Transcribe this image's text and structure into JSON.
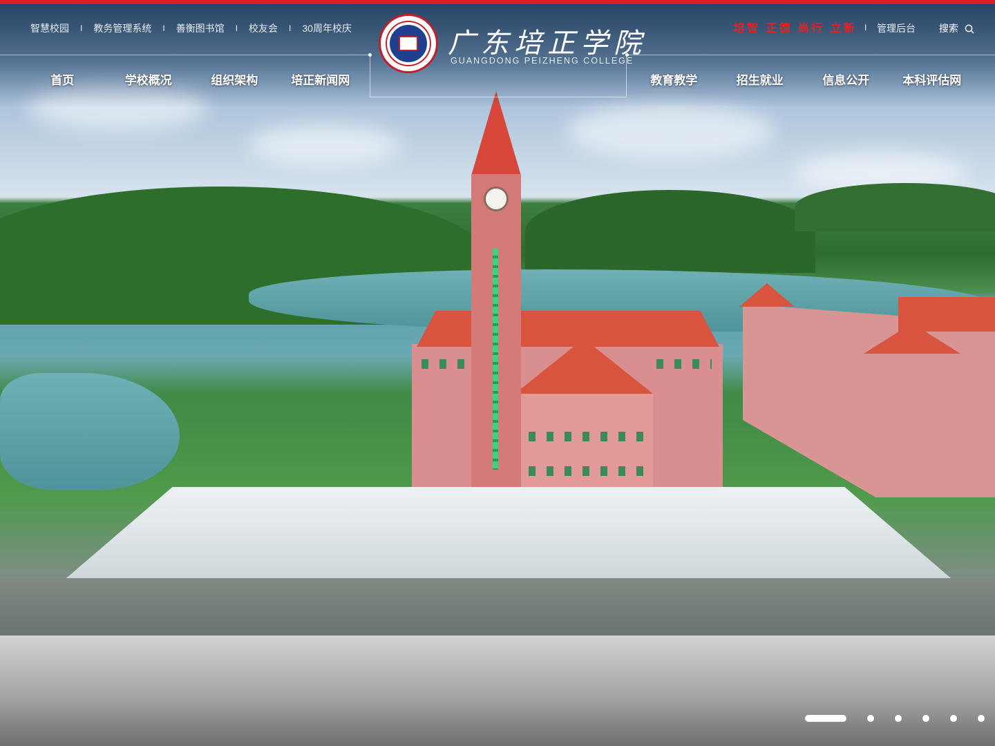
{
  "header": {
    "top_links": [
      {
        "label": "智慧校园"
      },
      {
        "label": "教务管理系统"
      },
      {
        "label": "善衡图书馆"
      },
      {
        "label": "校友会"
      },
      {
        "label": "30周年校庆"
      }
    ],
    "separator": "I",
    "brand_cn": "广东培正学院",
    "brand_en": "GUANGDONG PEIZHENG COLLEGE",
    "motto": "培智 正德 尚行 立新",
    "admin_label": "管理后台",
    "search_label": "搜索"
  },
  "nav": {
    "left": [
      {
        "label": "首页"
      },
      {
        "label": "学校概况"
      },
      {
        "label": "组织架构"
      },
      {
        "label": "培正新闻网"
      }
    ],
    "right": [
      {
        "label": "教育教学"
      },
      {
        "label": "招生就业"
      },
      {
        "label": "信息公开"
      },
      {
        "label": "本科评估网"
      }
    ]
  },
  "carousel": {
    "slide_count": 6,
    "active_index": 0
  },
  "colors": {
    "accent_red": "#e01e1e",
    "logo_blue": "#1f3f8f"
  }
}
